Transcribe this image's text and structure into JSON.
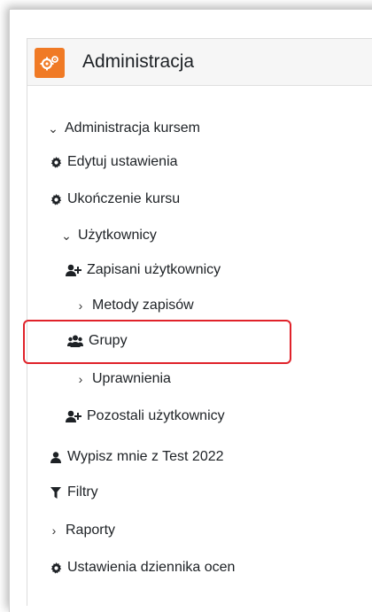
{
  "block": {
    "title": "Administracja",
    "icon": "gears-icon",
    "accent_color": "#f07a25"
  },
  "tree": {
    "course_admin": "Administracja kursem",
    "edit_settings": "Edytuj ustawienia",
    "course_completion": "Ukończenie kursu",
    "users": "Użytkownicy",
    "enrolled_users": "Zapisani użytkownicy",
    "enrolment_methods": "Metody zapisów",
    "groups": "Grupy",
    "permissions": "Uprawnienia",
    "other_users": "Pozostali użytkownicy",
    "unenrol": "Wypisz mnie z Test 2022",
    "filters": "Filtry",
    "reports": "Raporty",
    "gradebook_setup": "Ustawienia dziennika ocen"
  },
  "highlight_color": "#e0222a"
}
